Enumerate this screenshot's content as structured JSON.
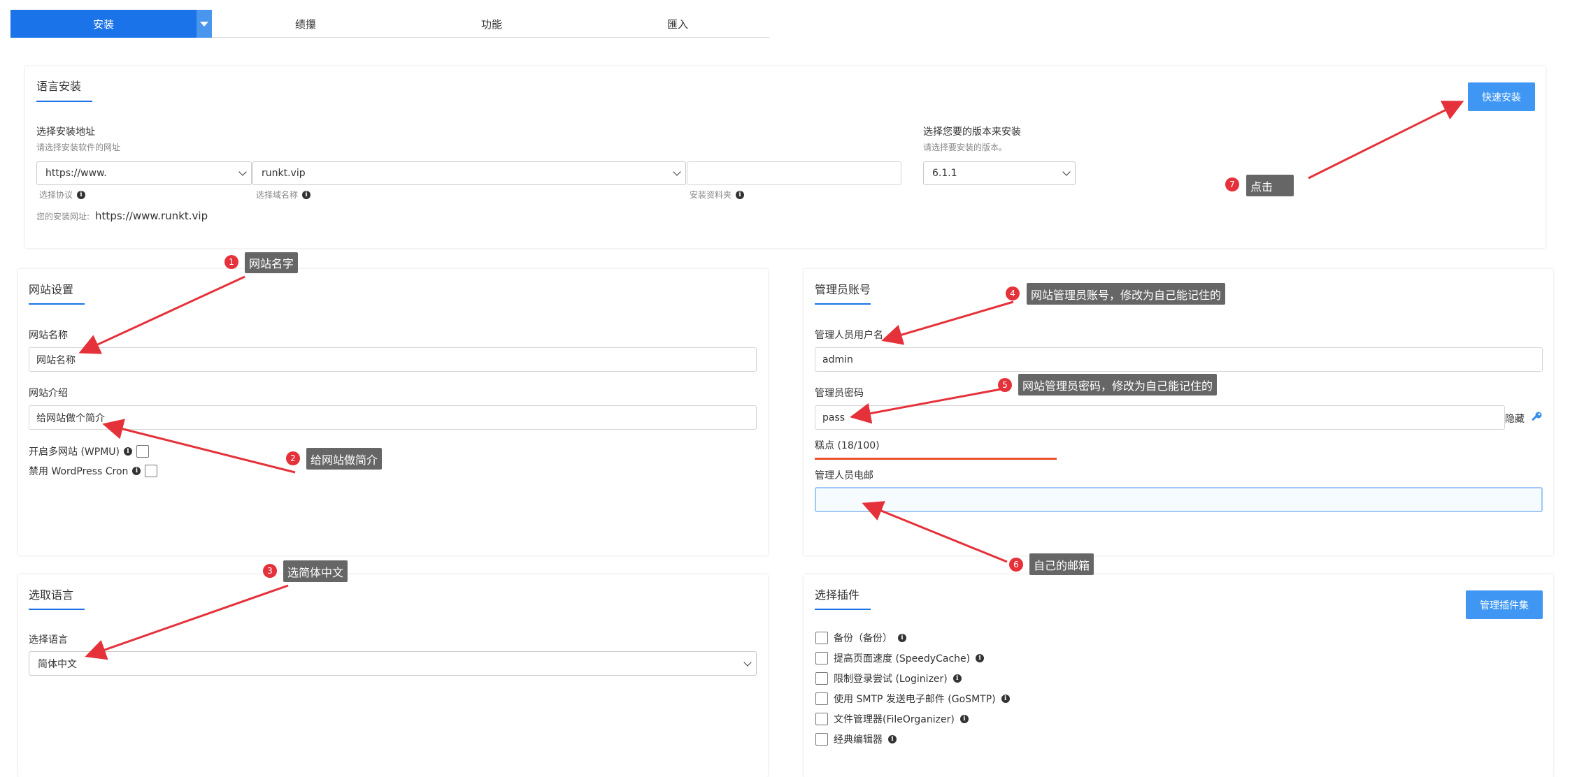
{
  "tabs": {
    "items": [
      "安装",
      "绩攥",
      "功能",
      "匯入"
    ]
  },
  "install": {
    "title": "语言安装",
    "location_label": "选择安装地址",
    "location_sub": "请选择安装软件的网址",
    "protocol_value": "https://www.",
    "protocol_caption": "选择协议",
    "domain_value": "runkt.vip",
    "domain_caption": "选择域名称",
    "folder_caption": "安装资料夹",
    "url_prefix": "您的安装网址:",
    "url_value": "https://www.runkt.vip",
    "version_label": "选择您要的版本来安装",
    "version_sub": "请选择要安装的版本。",
    "version_value": "6.1.1",
    "quick_install": "快速安装"
  },
  "site": {
    "title": "网站设置",
    "name_label": "网站名称",
    "name_value": "网站名称",
    "desc_label": "网站介绍",
    "desc_value": "给网站做个简介",
    "wpmu_label": "开启多网站 (WPMU)",
    "cron_label": "禁用 WordPress Cron"
  },
  "admin": {
    "title": "管理员账号",
    "user_label": "管理人员用户名",
    "user_value": "admin",
    "pass_label": "管理员密码",
    "pass_value": "pass",
    "hide_label": "隐藏",
    "strength": "糕点 (18/100)",
    "email_label": "管理人员电邮"
  },
  "language": {
    "title": "选取语言",
    "label": "选择语言",
    "value": "简体中文"
  },
  "plugins": {
    "title": "选择插件",
    "manage": "管理插件集",
    "items": [
      "备份（备份）",
      "提高页面速度 (SpeedyCache)",
      "限制登录尝试 (Loginizer)",
      "使用 SMTP 发送电子邮件 (GoSMTP)",
      "文件管理器(FileOrganizer)",
      "经典编辑器"
    ]
  },
  "annotations": [
    {
      "num": "1",
      "text": "网站名字"
    },
    {
      "num": "2",
      "text": "给网站做简介"
    },
    {
      "num": "3",
      "text": "选简体中文"
    },
    {
      "num": "4",
      "text": "网站管理员账号，修改为自己能记住的"
    },
    {
      "num": "5",
      "text": "网站管理员密码，修改为自己能记住的"
    },
    {
      "num": "6",
      "text": "自己的邮箱"
    },
    {
      "num": "7",
      "text": "点击"
    }
  ],
  "icons": {
    "info": "info-icon",
    "key": "key-icon",
    "dropdown": "chevron-down-icon"
  },
  "colors": {
    "primary": "#1a73e8",
    "button": "#3f97f3",
    "annotation": "#e5323a",
    "strength_bar": "#e8542a"
  }
}
